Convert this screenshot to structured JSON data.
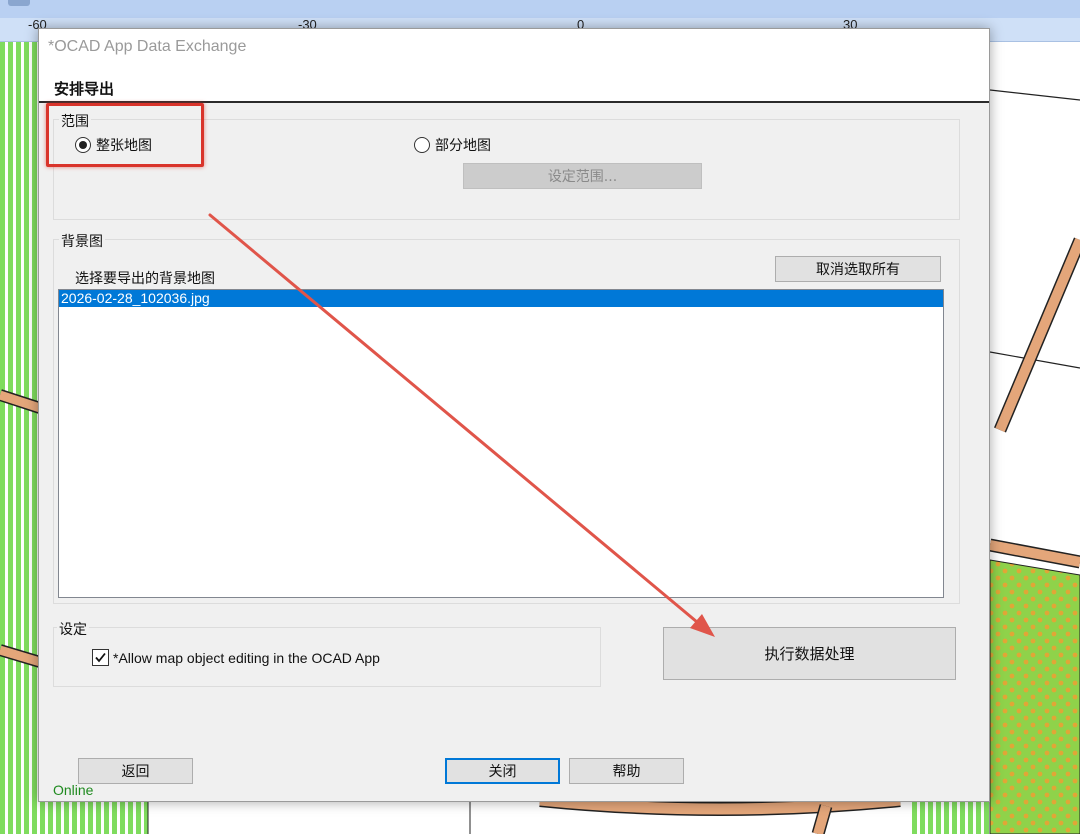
{
  "map": {
    "ruler_labels": [
      "-60",
      "-30",
      "0",
      "30"
    ],
    "colors": {
      "ruler_bg": "#cfe0f7",
      "green_stripes": "#7fdc5e",
      "road_fill": "#e4a67a",
      "road_edge": "#222222",
      "dotted_area": "#8fd24a",
      "dot_color": "#e1a636"
    }
  },
  "dialog": {
    "title": "*OCAD App Data Exchange",
    "heading": "安排导出",
    "range": {
      "label": "范围",
      "option_whole": "整张地图",
      "option_partial": "部分地图",
      "selected": "整张地图",
      "set_range_button": "设定范围..."
    },
    "background": {
      "label": "背景图",
      "instruction": "选择要导出的背景地图",
      "deselect_all_button": "取消选取所有",
      "items": [
        "2026-02-28_102036.jpg"
      ],
      "selected_item": "2026-02-28_102036.jpg"
    },
    "settings": {
      "label": "设定",
      "allow_editing_label": "*Allow map object editing in the OCAD App",
      "allow_editing_checked": true
    },
    "execute_button": "执行数据处理",
    "back_button": "返回",
    "close_button": "关闭",
    "help_button": "帮助",
    "status": "Online"
  },
  "annotation": {
    "color": "#d9342b",
    "highlight_target": "整张地图",
    "arrow_target": "执行数据处理"
  }
}
